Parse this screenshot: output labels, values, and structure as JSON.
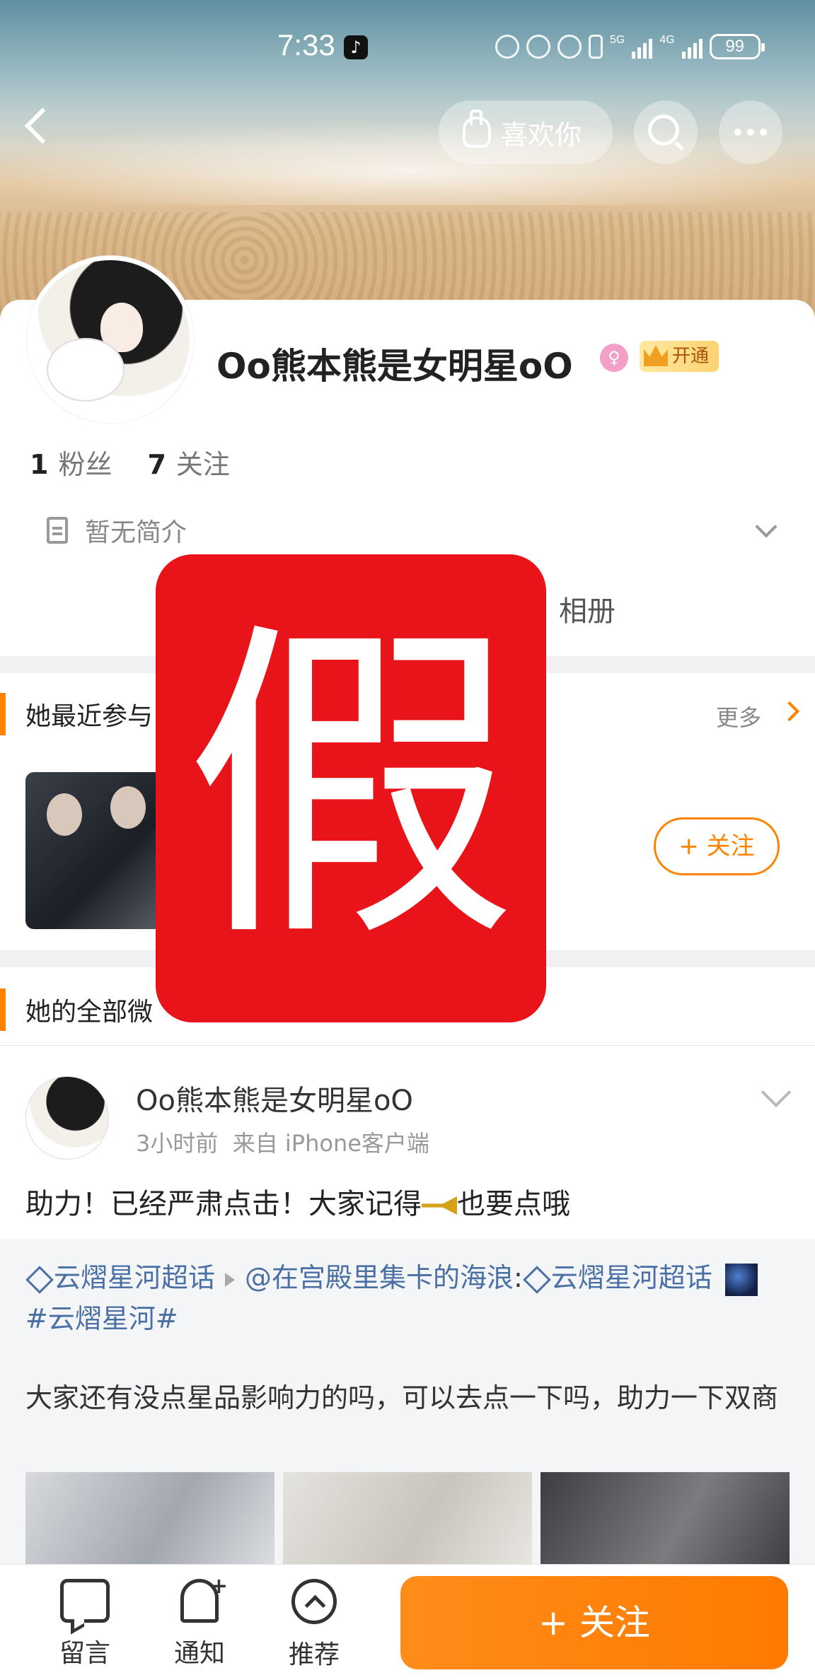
{
  "status_bar": {
    "time": "7:33",
    "net_5g": "5G",
    "net_4g": "4G",
    "battery": "99"
  },
  "header": {
    "like_label": "喜欢你"
  },
  "profile": {
    "username": "Oo熊本熊是女明星oO",
    "vip_label": "开通",
    "fans_count": "1",
    "fans_label": "粉丝",
    "follow_count": "7",
    "follow_label": "关注",
    "bio": "暂无简介",
    "tab_album": "相册"
  },
  "supertopic_section": {
    "title": "她最近参与",
    "more": "更多",
    "follow_button": "+ 关注"
  },
  "posts_section": {
    "title": "她的全部微"
  },
  "post": {
    "author": "Oo熊本熊是女明星oO",
    "time": "3小时前",
    "source": "来自 iPhone客户端",
    "text_before_icon": "助力！已经严肃点击！大家记得",
    "text_after_icon": "也要点哦",
    "repost": {
      "topic": "云熠星河超话",
      "mention": "@在宫殿里集卡的海浪",
      "colon": ":",
      "topic2": "云熠星河超话",
      "hashtag": "#云熠星河#",
      "text": "大家还有没点星品影响力的吗，可以去点一下吗，助力一下双商"
    }
  },
  "bottom_bar": {
    "message": "留言",
    "notify": "通知",
    "recommend": "推荐",
    "follow": "+ 关注"
  },
  "stamp": {
    "text": "假",
    "color": "#e8141a"
  },
  "colors": {
    "accent": "#ff8200",
    "link": "#4a6fa5"
  }
}
